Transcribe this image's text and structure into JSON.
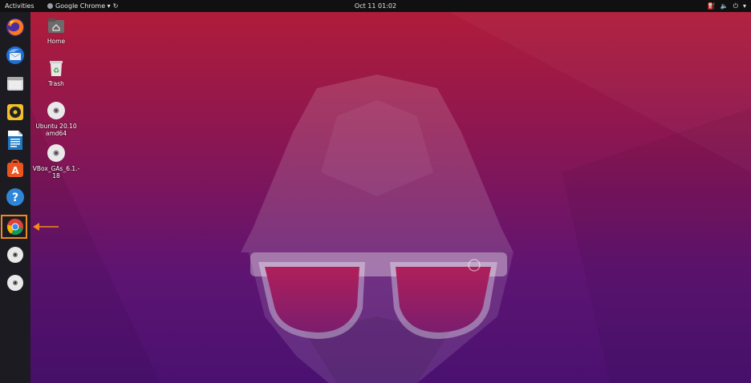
{
  "topbar": {
    "activities": "Activities",
    "app_name": "Google Chrome ▾",
    "clock": "Oct 11  01:02"
  },
  "dock": {
    "items": [
      {
        "name": "firefox-icon"
      },
      {
        "name": "thunderbird-icon"
      },
      {
        "name": "files-icon"
      },
      {
        "name": "rhythmbox-icon"
      },
      {
        "name": "libreoffice-writer-icon"
      },
      {
        "name": "ubuntu-software-icon"
      },
      {
        "name": "help-icon"
      },
      {
        "name": "chrome-icon",
        "highlighted": true
      },
      {
        "name": "disc-icon"
      },
      {
        "name": "disc-icon"
      }
    ],
    "highlight_color": "#f08a1d"
  },
  "desktop": {
    "icons": [
      {
        "label": "Home"
      },
      {
        "label": "Trash"
      },
      {
        "label": "Ubuntu 20.10\namd64"
      },
      {
        "label": "VBox_GAs_6.1.-\n18"
      }
    ]
  },
  "colors": {
    "wallpaper_top": "#b5213a",
    "wallpaper_bottom": "#4b1270",
    "dock_bg": "#1d1b22",
    "topbar_bg": "#101010"
  }
}
